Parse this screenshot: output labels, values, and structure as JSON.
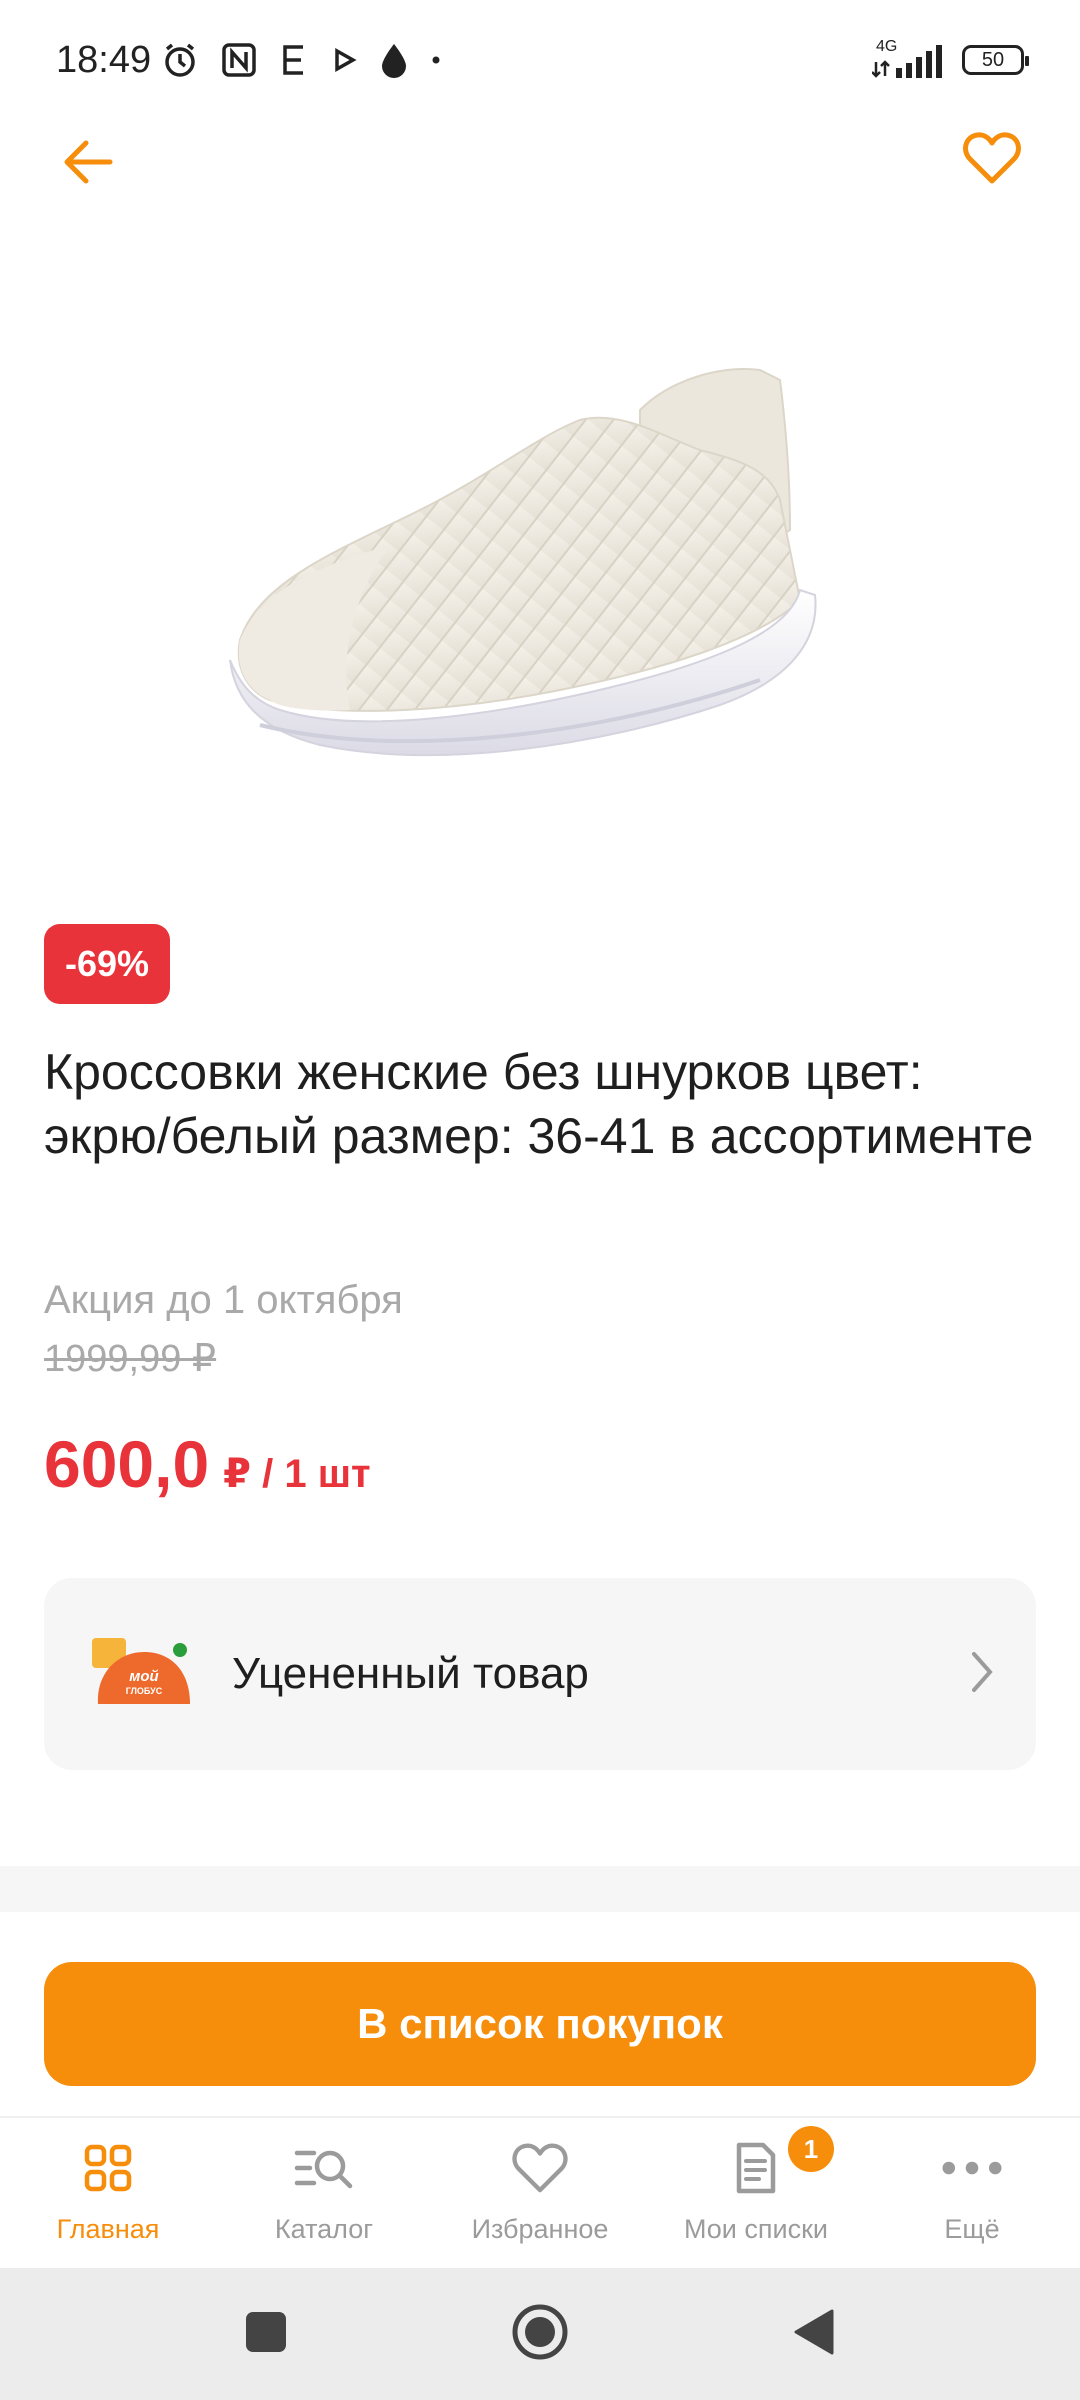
{
  "status_bar": {
    "time": "18:49",
    "network": "4G",
    "battery": "50"
  },
  "top_bar": {
    "back_icon": "arrow-left-icon",
    "favorite_icon": "heart-outline-icon"
  },
  "product": {
    "image_icon": "sneaker-image",
    "discount": "-69%",
    "title": "Кроссовки женские без шнурков цвет: экрю/белый размер: 36-41 в ассортименте",
    "promo": "Акция до 1 октября",
    "old_price": "1999,99 ₽",
    "price": "600,0",
    "price_unit": "₽ / 1 шт"
  },
  "markdown_card": {
    "label": "Уцененный товар",
    "logo_text_1": "мой",
    "logo_text_2": "глобус"
  },
  "cta": {
    "label": "В список покупок"
  },
  "bottom_nav": {
    "items": [
      {
        "label": "Главная",
        "icon": "home-grid-icon",
        "active": true
      },
      {
        "label": "Каталог",
        "icon": "catalog-search-icon",
        "active": false
      },
      {
        "label": "Избранное",
        "icon": "heart-icon",
        "active": false
      },
      {
        "label": "Мои списки",
        "icon": "list-icon",
        "active": false,
        "badge": "1"
      },
      {
        "label": "Ещё",
        "icon": "more-dots-icon",
        "active": false
      }
    ]
  },
  "colors": {
    "accent": "#f68d0b",
    "discount": "#e8333a",
    "muted": "#a9a9a9"
  }
}
